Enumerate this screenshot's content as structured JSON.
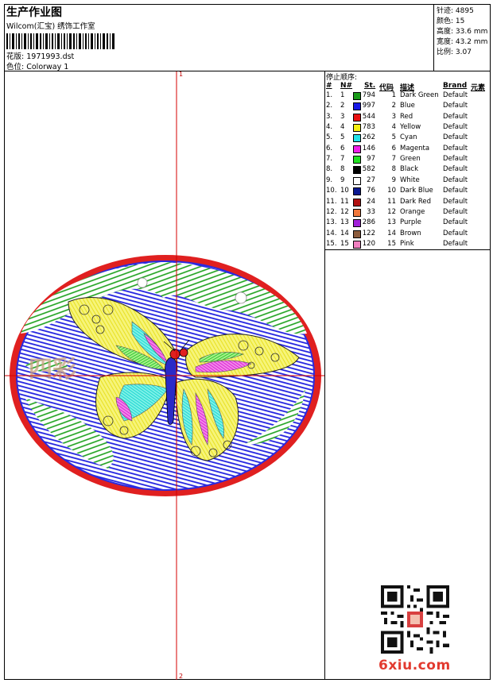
{
  "header": {
    "title": "生产作业图",
    "company": "Wilcom(汇宝) 绣饰工作室",
    "design_label": "花版:",
    "design_value": "1971993.dst",
    "colorway_label": "色位:",
    "colorway_value": "Colorway 1"
  },
  "stats": [
    {
      "label": "针迹:",
      "value": "4895"
    },
    {
      "label": "颜色:",
      "value": "15"
    },
    {
      "label": "高度:",
      "value": "33.6 mm"
    },
    {
      "label": "宽度:",
      "value": "43.2 mm"
    },
    {
      "label": "比例:",
      "value": "3.07"
    }
  ],
  "stop_sequence": {
    "title": "停止顺序:",
    "columns": [
      "#",
      "N#",
      "St.",
      "代码",
      "描述",
      "Brand",
      "元素"
    ],
    "rows": [
      {
        "idx": "1.",
        "n": "1",
        "color": "#1a9c1a",
        "st": "794",
        "code": "1",
        "desc": "Dark Green",
        "brand": "Default"
      },
      {
        "idx": "2.",
        "n": "2",
        "color": "#1818e8",
        "st": "997",
        "code": "2",
        "desc": "Blue",
        "brand": "Default"
      },
      {
        "idx": "3.",
        "n": "3",
        "color": "#e81010",
        "st": "544",
        "code": "3",
        "desc": "Red",
        "brand": "Default"
      },
      {
        "idx": "4.",
        "n": "4",
        "color": "#f4f010",
        "st": "783",
        "code": "4",
        "desc": "Yellow",
        "brand": "Default"
      },
      {
        "idx": "5.",
        "n": "5",
        "color": "#22e2e8",
        "st": "262",
        "code": "5",
        "desc": "Cyan",
        "brand": "Default"
      },
      {
        "idx": "6.",
        "n": "6",
        "color": "#f01ee8",
        "st": "146",
        "code": "6",
        "desc": "Magenta",
        "brand": "Default"
      },
      {
        "idx": "7.",
        "n": "7",
        "color": "#20e020",
        "st": "97",
        "code": "7",
        "desc": "Green",
        "brand": "Default"
      },
      {
        "idx": "8.",
        "n": "8",
        "color": "#000000",
        "st": "582",
        "code": "8",
        "desc": "Black",
        "brand": "Default"
      },
      {
        "idx": "9.",
        "n": "9",
        "color": "#ffffff",
        "st": "27",
        "code": "9",
        "desc": "White",
        "brand": "Default"
      },
      {
        "idx": "10.",
        "n": "10",
        "color": "#0a1890",
        "st": "76",
        "code": "10",
        "desc": "Dark Blue",
        "brand": "Default"
      },
      {
        "idx": "11.",
        "n": "11",
        "color": "#b01010",
        "st": "24",
        "code": "11",
        "desc": "Dark Red",
        "brand": "Default"
      },
      {
        "idx": "12.",
        "n": "12",
        "color": "#f0783c",
        "st": "33",
        "code": "12",
        "desc": "Orange",
        "brand": "Default"
      },
      {
        "idx": "13.",
        "n": "13",
        "color": "#a020d8",
        "st": "286",
        "code": "13",
        "desc": "Purple",
        "brand": "Default"
      },
      {
        "idx": "14.",
        "n": "14",
        "color": "#8c5c3c",
        "st": "122",
        "code": "14",
        "desc": "Brown",
        "brand": "Default"
      },
      {
        "idx": "15.",
        "n": "15",
        "color": "#f080c0",
        "st": "120",
        "code": "15",
        "desc": "Pink",
        "brand": "Default"
      }
    ]
  },
  "design": {
    "axis_top_label": "1",
    "axis_bottom_label": "2",
    "monogram": "四彩"
  },
  "watermark": "6xiu.com",
  "colors": {
    "axis": "#d40000",
    "border_red": "#e02020",
    "field_green": "#1aa01a",
    "field_blue": "#2020e0",
    "wing_yellow": "#f2f040",
    "wing_cyan": "#30e0d8",
    "wing_magenta": "#f020e0"
  }
}
